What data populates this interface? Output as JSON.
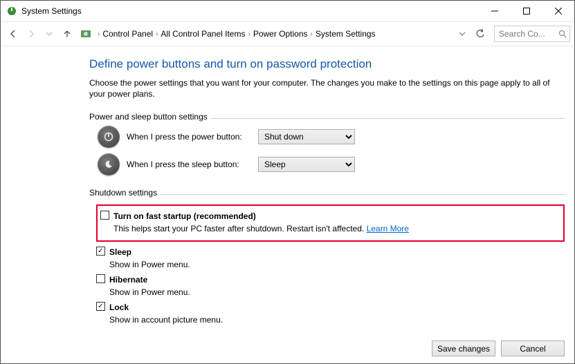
{
  "window": {
    "title": "System Settings"
  },
  "breadcrumb": {
    "items": [
      "Control Panel",
      "All Control Panel Items",
      "Power Options",
      "System Settings"
    ]
  },
  "search": {
    "placeholder": "Search Co..."
  },
  "page": {
    "heading": "Define power buttons and turn on password protection",
    "intro": "Choose the power settings that you want for your computer. The changes you make to the settings on this page apply to all of your power plans."
  },
  "buttons_section": {
    "legend": "Power and sleep button settings",
    "power_label": "When I press the power button:",
    "power_value": "Shut down",
    "sleep_label": "When I press the sleep button:",
    "sleep_value": "Sleep"
  },
  "shutdown_section": {
    "legend": "Shutdown settings",
    "fast": {
      "checked": false,
      "title": "Turn on fast startup (recommended)",
      "desc": "This helps start your PC faster after shutdown. Restart isn't affected. ",
      "link": "Learn More"
    },
    "sleep": {
      "checked": true,
      "title": "Sleep",
      "desc": "Show in Power menu."
    },
    "hibernate": {
      "checked": false,
      "title": "Hibernate",
      "desc": "Show in Power menu."
    },
    "lock": {
      "checked": true,
      "title": "Lock",
      "desc": "Show in account picture menu."
    }
  },
  "footer": {
    "save": "Save changes",
    "cancel": "Cancel"
  }
}
